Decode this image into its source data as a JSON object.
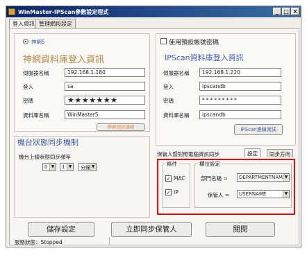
{
  "window": {
    "title": "WinMaster-IPScan參數設定程式",
    "min_btn": "_",
    "max_btn": "□",
    "close_btn": "×"
  },
  "tabs": [
    "登入資訊",
    "管理網段設定"
  ],
  "left": {
    "radio_label": "神網5",
    "group_title": "神網資料庫登入資訊",
    "fields": [
      {
        "label": "伺服器名稱",
        "value": "192.168.1.180"
      },
      {
        "label": "登入",
        "value": "sa"
      },
      {
        "label": "密碼",
        "value": "★★★★★★★"
      },
      {
        "label": "資料庫名稱",
        "value": "WinMaster5"
      }
    ],
    "test_button": "神網測試連線"
  },
  "right": {
    "checkbox_label": "使用預設帳號密碼",
    "group_title": "IPScan資料庫登入資訊",
    "fields": [
      {
        "label": "伺服器名稱",
        "value": "192.168.1.220"
      },
      {
        "label": "登入",
        "value": "ipscandb"
      },
      {
        "label": "密碼",
        "value": "*********"
      },
      {
        "label": "資料庫名稱",
        "value": "ipscandb"
      }
    ],
    "test_button": "IPScan連線測試"
  },
  "sync": {
    "title": "機台狀態同步機制",
    "label": "機台上線狀態同步頻率",
    "value1": "0",
    "value2": "1",
    "unit": "分鐘"
  },
  "custodian": {
    "tabs": [
      "保管人暨對照電腦資訊同步",
      "設定",
      "同步方向"
    ],
    "condition_legend": "條件",
    "conditions": [
      {
        "label": "MAC",
        "checked": "✓"
      },
      {
        "label": "IP",
        "checked": "✓"
      }
    ],
    "field_legend": "欄位設定",
    "mappings": [
      {
        "label": "部門名稱 =",
        "value": "DEPARTMENTNAME"
      },
      {
        "label": "保管人 =",
        "value": "USERNAME"
      }
    ],
    "highlight_color": "#e01010"
  },
  "buttons": {
    "save": "儲存設定",
    "sync_now": "立即同步保管人",
    "close": "關閉"
  },
  "status": {
    "text": "服務狀態：Stopped"
  }
}
